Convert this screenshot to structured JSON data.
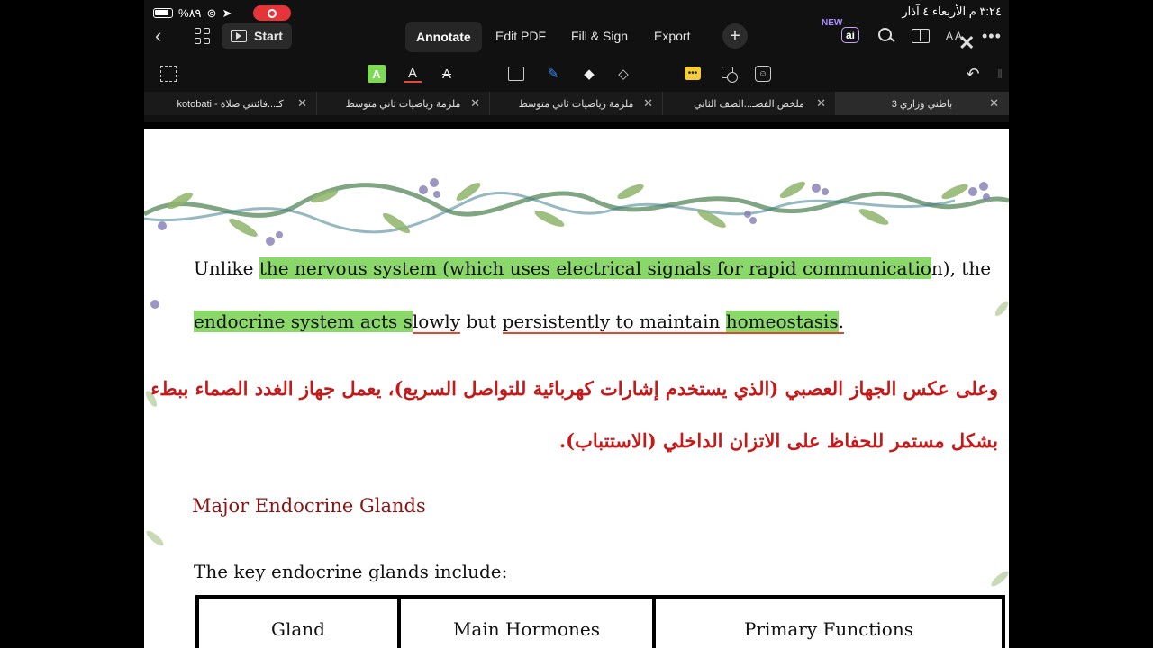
{
  "status": {
    "battery": "%٨٩",
    "datetime": "٣:٢٤ م  الأربعاء ٤ آذار"
  },
  "toolbar": {
    "start_label": "Start",
    "tabs": [
      {
        "label": "Annotate"
      },
      {
        "label": "Edit PDF"
      },
      {
        "label": "Fill & Sign"
      },
      {
        "label": "Export"
      }
    ],
    "new_badge": "NEW",
    "ai_label": "ai",
    "text_size": "A A"
  },
  "doc_tabs": [
    {
      "label": "كـ...فائتني صلاة - kotobati"
    },
    {
      "label": "ملزمة رياضيات ثاني متوسط"
    },
    {
      "label": "ملزمة رياضيات ثاني متوسط"
    },
    {
      "label": "ملخص الفصـ...الصف الثاني"
    },
    {
      "label": "باطني وزاري 3"
    }
  ],
  "document": {
    "line1": {
      "a": "Unlike ",
      "b": "the nervous system (which uses electrical signals for rapid communicatio",
      "c": "n), the"
    },
    "line2": {
      "a": "endocrine system acts s",
      "b": "lowly",
      "c": " but ",
      "d": "persistently to maintain ",
      "e": "homeostasis",
      "f": "."
    },
    "arabic_line1": "وعلى عكس الجهاز العصبي (الذي يستخدم إشارات كهربائية للتواصل السريع)، يعمل جهاز الغدد الصماء ببطء ولكن",
    "arabic_line2": "بشكل مستمر للحفاظ على الاتزان الداخلي (الاستتباب).",
    "heading": "Major Endocrine Glands",
    "intro": "The key endocrine glands include:",
    "table_headers": [
      "Gland",
      "Main Hormones",
      "Primary Functions"
    ]
  },
  "colors": {
    "highlight": "#8bd86a",
    "underline": "#e04a2c",
    "arabic_text": "#c41a1a",
    "heading": "#8a1414"
  }
}
